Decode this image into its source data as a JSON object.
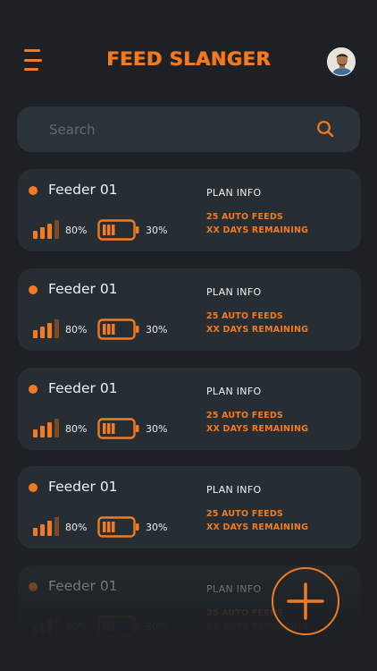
{
  "header": {
    "title": "FEED SLANGER",
    "menu_icon": "hamburger-icon",
    "avatar_icon": "user-avatar"
  },
  "search": {
    "placeholder": "Search",
    "icon": "search-icon"
  },
  "feeders": [
    {
      "name": "Feeder 01",
      "signal": "80%",
      "battery": "30%",
      "plan_title": "PLAN INFO",
      "plan_feeds": "25 AUTO FEEDS",
      "plan_days": "XX DAYS REMAINING"
    },
    {
      "name": "Feeder 01",
      "signal": "80%",
      "battery": "30%",
      "plan_title": "PLAN INFO",
      "plan_feeds": "25 AUTO FEEDS",
      "plan_days": "XX DAYS REMAINING"
    },
    {
      "name": "Feeder 01",
      "signal": "80%",
      "battery": "30%",
      "plan_title": "PLAN INFO",
      "plan_feeds": "25 AUTO FEEDS",
      "plan_days": "XX DAYS REMAINING"
    },
    {
      "name": "Feeder 01",
      "signal": "80%",
      "battery": "30%",
      "plan_title": "PLAN INFO",
      "plan_feeds": "25 AUTO FEEDS",
      "plan_days": "XX DAYS REMAINING"
    },
    {
      "name": "Feeder 01",
      "signal": "80%",
      "battery": "30%",
      "plan_title": "PLAN INFO",
      "plan_feeds": "25 AUTO FEEDS",
      "plan_days": "XX DAYS REMAINING"
    }
  ],
  "fab": {
    "icon": "plus-icon"
  },
  "colors": {
    "accent": "#f27a22",
    "background": "#1d2125",
    "card": "#272e33",
    "search": "#2a3338"
  }
}
